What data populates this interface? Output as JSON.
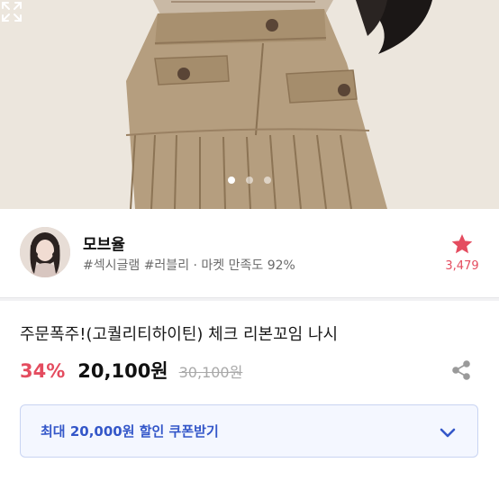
{
  "hero": {
    "active_slide": 1,
    "slide_count": 3
  },
  "seller": {
    "name": "모브율",
    "tags": "#섹시글램 #러블리 · 마켓 만족도 92%",
    "favorite_count": "3,479"
  },
  "product": {
    "title": "주문폭주!(고퀄리티하이틴) 체크 리본꼬임 나시",
    "discount": "34%",
    "price": "20,100원",
    "original_price": "30,100원"
  },
  "coupon": {
    "label": "최대 20,000원 할인 쿠폰받기"
  },
  "icons": {
    "expand": "expand-icon",
    "star": "star-icon",
    "share": "share-icon",
    "chevron": "chevron-down-icon"
  },
  "colors": {
    "accent_red": "#e44c5f",
    "coupon_blue": "#3457c9",
    "coupon_bg": "#f4f7ff"
  }
}
